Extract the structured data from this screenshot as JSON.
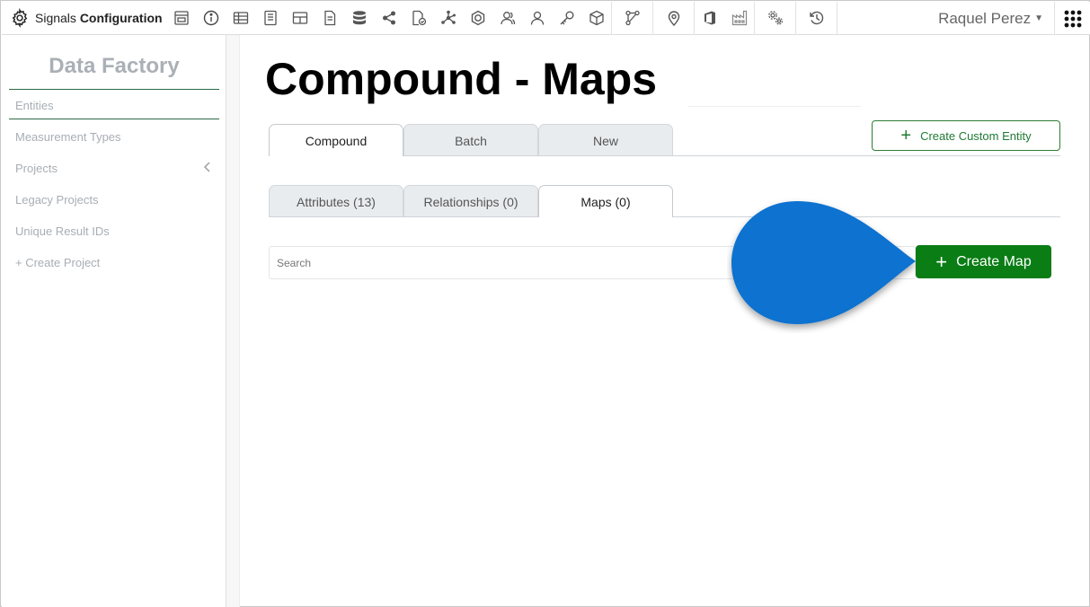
{
  "app": {
    "brand_light": "Signals",
    "brand_bold": "Configuration",
    "user_name": "Raquel Perez",
    "icons": [
      "layout-icon",
      "info-icon",
      "table-icon",
      "notebook-icon",
      "grid-icon",
      "document-icon",
      "database-icon",
      "share-icon",
      "file-check-icon",
      "molecule-icon",
      "ai-icon",
      "users-icon",
      "user-icon",
      "key-icon",
      "cube-icon",
      "workflow-icon",
      "location-icon",
      "office-icon",
      "factory-icon",
      "settings-icon",
      "history-icon"
    ]
  },
  "sidebar": {
    "title": "Data Factory",
    "items": [
      {
        "label": "Entities"
      },
      {
        "label": "Measurement Types"
      },
      {
        "label": "Projects"
      },
      {
        "label": "Legacy Projects"
      },
      {
        "label": "Unique Result IDs"
      },
      {
        "label": "+ Create Project"
      }
    ]
  },
  "main": {
    "title": "Compound - Maps",
    "entity_tabs": [
      "Compound",
      "Batch",
      "New"
    ],
    "create_entity_label": "Create Custom Entity",
    "sub_tabs": [
      "Attributes (13)",
      "Relationships (0)",
      "Maps (0)"
    ],
    "search_placeholder": "Search",
    "create_map_label": "Create Map"
  },
  "colors": {
    "accent_green": "#0a7d15",
    "pointer_blue": "#0a72d0",
    "sidebar_rule": "#2b6b47"
  }
}
